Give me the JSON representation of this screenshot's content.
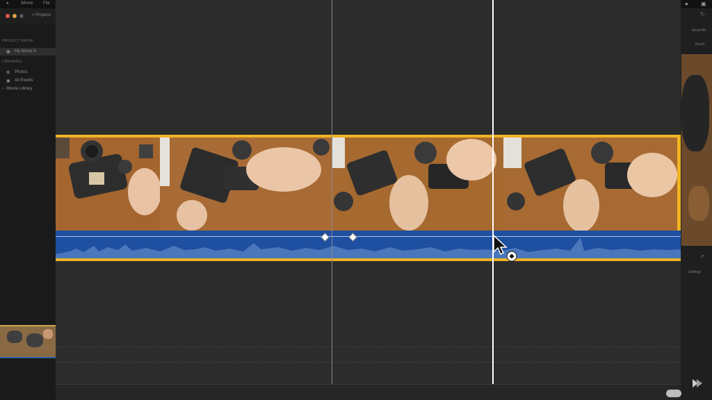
{
  "menubar": {
    "apple_icon": "apple-icon",
    "app_name": "iMovie",
    "menu_file": "File"
  },
  "titlebar": {
    "projects_label": "< Projects"
  },
  "sidebar": {
    "project_media_heading": "PROJECT MEDIA",
    "project_item": "My Movie 6",
    "libraries_heading": "LIBRARIES",
    "items": [
      {
        "icon": "photos-icon",
        "label": "Photos"
      },
      {
        "icon": "all-events-icon",
        "label": "All Events"
      },
      {
        "icon": "disclosure-icon",
        "label": "iMovie Library"
      }
    ]
  },
  "right_panel": {
    "reset_label": "Reset All",
    "reset2_label": "Reset",
    "settings_label": "Settings"
  },
  "colors": {
    "clip_border": "#f0b323",
    "audio_wave": "#1f4fa0",
    "playhead": "#ffffff",
    "skimmer": "#8a8a8a"
  }
}
